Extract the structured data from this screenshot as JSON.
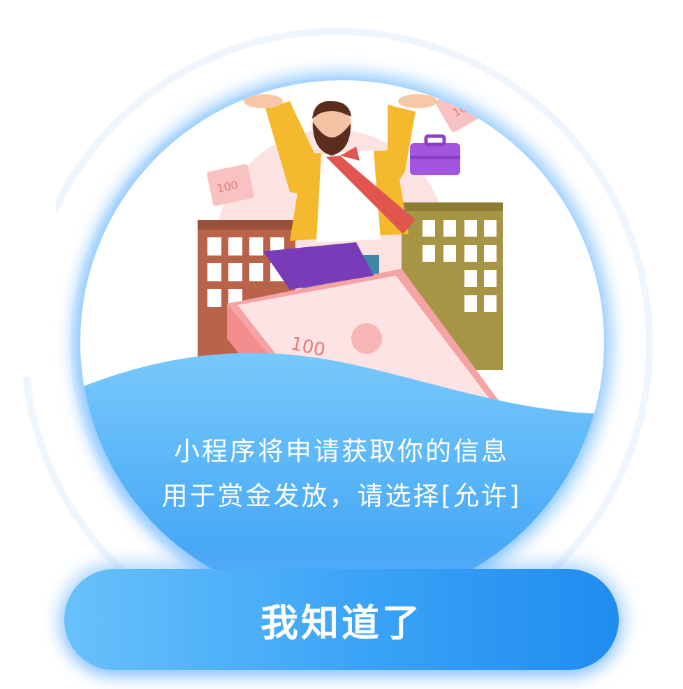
{
  "dialog": {
    "message_line1": "小程序将申请获取你的信息",
    "message_line2": "用于赏金发放，请选择[允许]",
    "confirm_label": "我知道了"
  },
  "illustration": {
    "banknote_text": "100",
    "subject": "businessman-celebrating-on-money-stack"
  },
  "colors": {
    "primary_blue": "#3aa3f6",
    "light_blue": "#68c1fb",
    "deep_blue": "#1f8cf0",
    "text": "#ffffff"
  }
}
